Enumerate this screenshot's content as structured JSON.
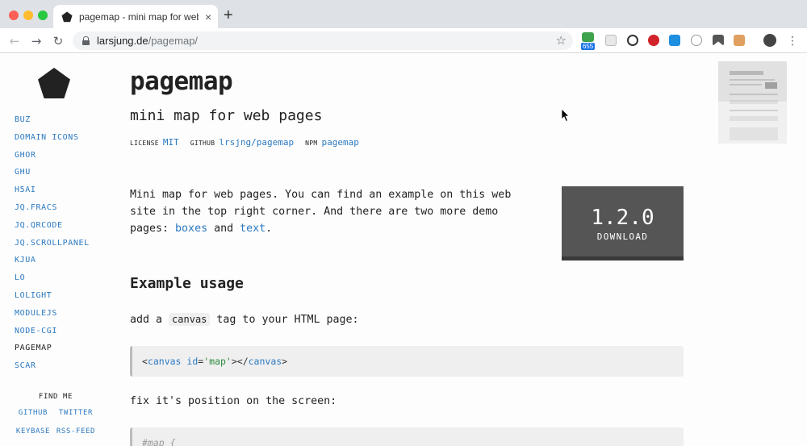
{
  "browser": {
    "tab_title": "pagemap - mini map for web pages",
    "tab_close": "×",
    "new_tab": "+",
    "url_host": "larsjung.de",
    "url_path": "/pagemap/",
    "extension_badge": "655"
  },
  "sidebar": {
    "items": [
      {
        "label": "BUZ"
      },
      {
        "label": "DOMAIN ICONS"
      },
      {
        "label": "GHOR"
      },
      {
        "label": "GHU"
      },
      {
        "label": "H5AI"
      },
      {
        "label": "JQ.FRACS"
      },
      {
        "label": "JQ.QRCODE"
      },
      {
        "label": "JQ.SCROLLPANEL"
      },
      {
        "label": "KJUA"
      },
      {
        "label": "LO"
      },
      {
        "label": "LOLIGHT"
      },
      {
        "label": "MODULEJS"
      },
      {
        "label": "NODE-CGI"
      },
      {
        "label": "PAGEMAP"
      },
      {
        "label": "SCAR"
      }
    ],
    "findme": {
      "title": "FIND ME",
      "github": "GITHUB",
      "twitter": "TWITTER",
      "keybase": "KEYBASE",
      "rss": "RSS-FEED"
    }
  },
  "main": {
    "title": "pagemap",
    "subtitle": "mini map for web pages",
    "meta": {
      "license_label": "LICENSE",
      "license_value": "MIT",
      "github_label": "GITHUB",
      "github_value": "lrsjng/pagemap",
      "npm_label": "NPM",
      "npm_value": "pagemap"
    },
    "intro": {
      "text_before": "Mini map for web pages. You can find an example on this web site in the top right corner. And there are two more demo pages: ",
      "link_boxes": "boxes",
      "text_and": " and ",
      "link_text": "text",
      "text_end": "."
    },
    "download": {
      "version": "1.2.0",
      "label": "DOWNLOAD"
    },
    "example_heading": "Example usage",
    "step1": {
      "before": "add a ",
      "code": "canvas",
      "after": " tag to your HTML page:"
    },
    "code1": {
      "open_lt": "<",
      "tag": "canvas",
      "attr": "id",
      "eq": "=",
      "value": "'map'",
      "close_open": "></",
      "close_tag": "canvas",
      "close_gt": ">"
    },
    "step2": "fix it's position on the screen:",
    "code2_first_line": "#map {"
  }
}
